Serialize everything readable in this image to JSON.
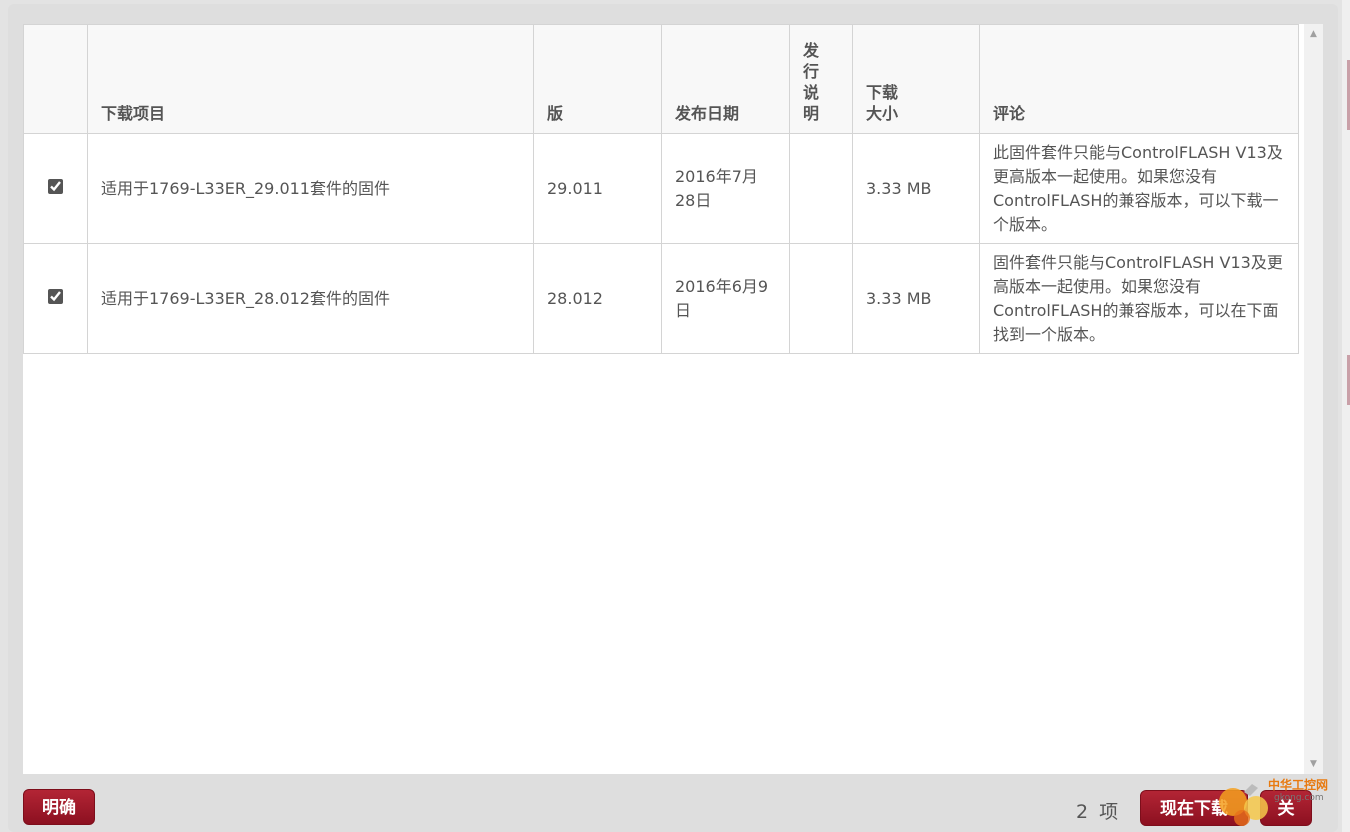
{
  "table": {
    "headers": {
      "item": "下载项目",
      "version": "版",
      "date": "发布日期",
      "notes": "发行说明",
      "size": "下载大小",
      "comment": "评论"
    },
    "rows": [
      {
        "checked": true,
        "item": "适用于1769-L33ER_29.011套件的固件",
        "version": "29.011",
        "date": "2016年7月28日",
        "notes": "",
        "size": "3.33 MB",
        "comment": "此固件套件只能与ControlFLASH V13及更高版本一起使用。如果您没有ControlFLASH的兼容版本，可以下载一个版本。"
      },
      {
        "checked": true,
        "item": "适用于1769-L33ER_28.012套件的固件",
        "version": "28.012",
        "date": "2016年6月9日",
        "notes": "",
        "size": "3.33 MB",
        "comment": "固件套件只能与ControlFLASH V13及更高版本一起使用。如果您没有ControlFLASH的兼容版本，可以在下面找到一个版本。"
      }
    ]
  },
  "footer": {
    "clear_label": "明确",
    "count": "2",
    "count_unit": "项",
    "download_label": "现在下载",
    "close_label": "关"
  },
  "watermark": {
    "text": "中华工控网",
    "url": "gkong.com"
  },
  "colors": {
    "button": "#9e1a2a",
    "header_bg": "#f8f8f8",
    "border": "#d4d4d4"
  }
}
